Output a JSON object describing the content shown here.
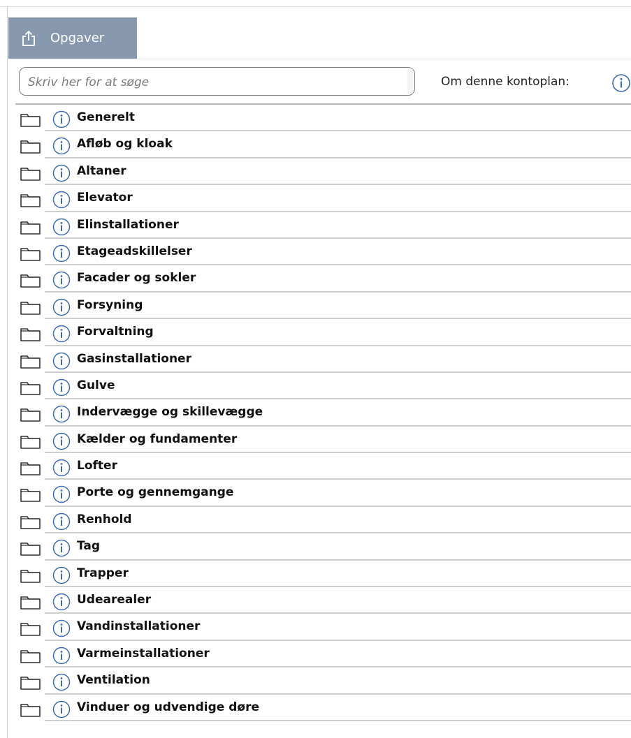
{
  "tab": {
    "label": "Opgaver",
    "icon": "share-icon"
  },
  "search": {
    "placeholder": "Skriv her for at søge",
    "value": ""
  },
  "about": {
    "label": "Om denne kontoplan:",
    "icon": "info-icon"
  },
  "colors": {
    "tab_bg": "#8797ad",
    "tab_text": "#ffffff",
    "info_stroke": "#3e6bb3"
  },
  "tree": {
    "items": [
      {
        "label": "Generelt"
      },
      {
        "label": "Afløb og kloak"
      },
      {
        "label": "Altaner"
      },
      {
        "label": "Elevator"
      },
      {
        "label": "Elinstallationer"
      },
      {
        "label": "Etageadskillelser"
      },
      {
        "label": "Facader og sokler"
      },
      {
        "label": "Forsyning"
      },
      {
        "label": "Forvaltning"
      },
      {
        "label": "Gasinstallationer"
      },
      {
        "label": "Gulve"
      },
      {
        "label": "Indervægge og skillevægge"
      },
      {
        "label": "Kælder og fundamenter"
      },
      {
        "label": "Lofter"
      },
      {
        "label": "Porte og gennemgange"
      },
      {
        "label": "Renhold"
      },
      {
        "label": "Tag"
      },
      {
        "label": "Trapper"
      },
      {
        "label": "Udearealer"
      },
      {
        "label": "Vandinstallationer"
      },
      {
        "label": "Varmeinstallationer"
      },
      {
        "label": "Ventilation"
      },
      {
        "label": "Vinduer og udvendige døre"
      }
    ]
  }
}
